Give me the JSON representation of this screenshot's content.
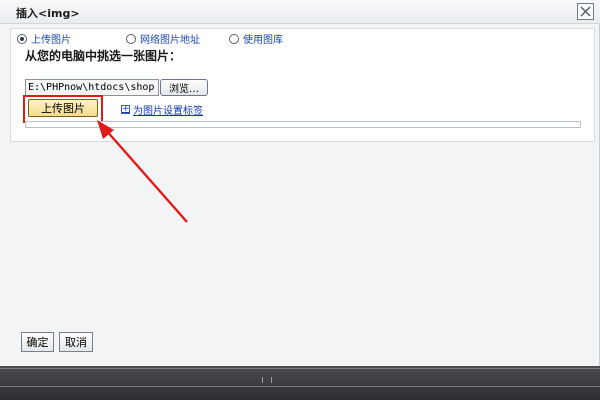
{
  "window": {
    "title": "插入<img>"
  },
  "tabs": [
    {
      "label": "上传图片",
      "checked": true
    },
    {
      "label": "网络图片地址",
      "checked": false
    },
    {
      "label": "使用图库",
      "checked": false
    }
  ],
  "upload": {
    "heading": "从您的电脑中挑选一张图片：",
    "file_path": "E:\\PHPnow\\htdocs\\shop",
    "browse_label": "浏览…",
    "upload_label": "上传图片",
    "caption_link": "为图片设置标签",
    "progress": 0
  },
  "footer": {
    "ok_label": "确定",
    "cancel_label": "取消"
  },
  "colors": {
    "highlight": "#e01b1b",
    "link": "#1238b0",
    "upload_button": "#f2dc8c"
  },
  "icons": {
    "close": "close-icon",
    "expand": "plus-box-icon",
    "annotation": "red-arrow"
  }
}
